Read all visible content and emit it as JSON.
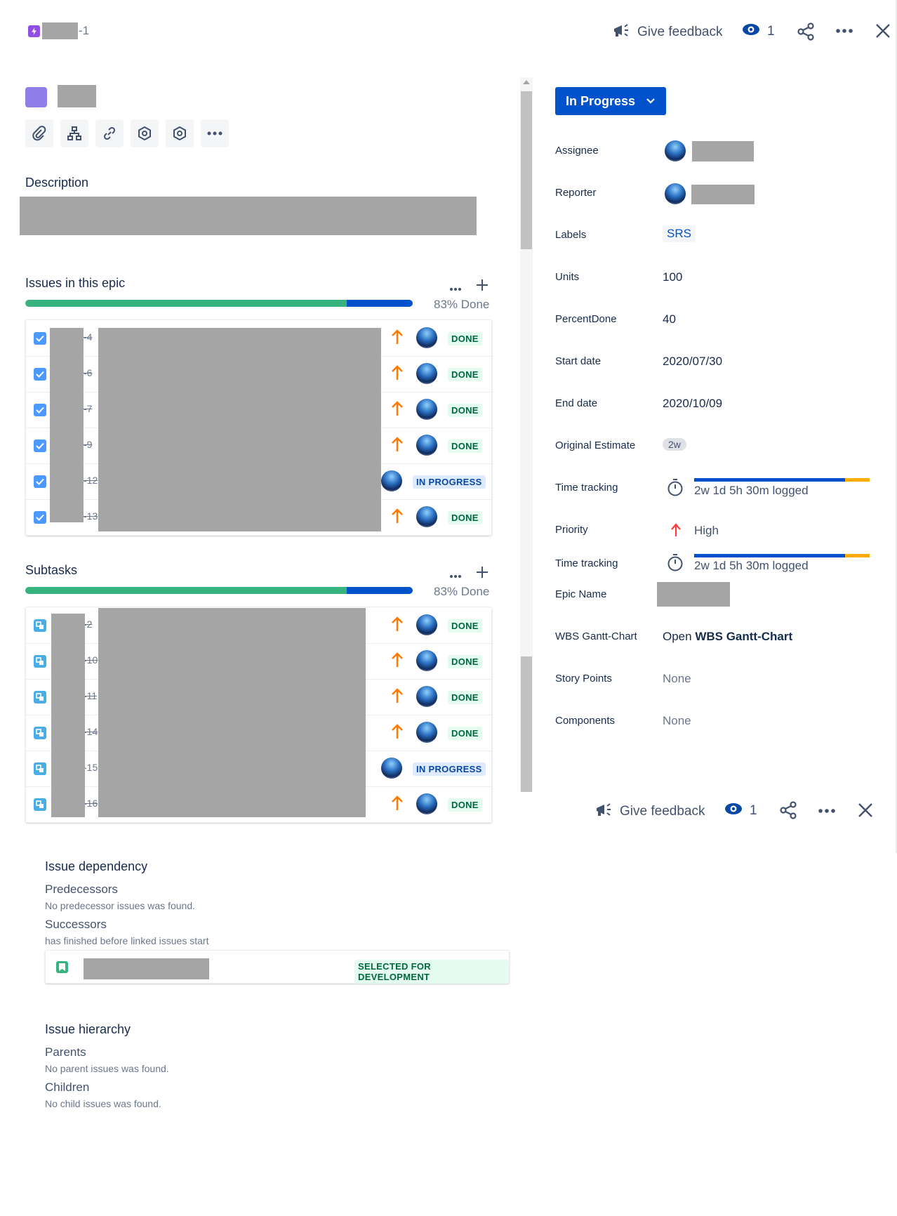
{
  "header": {
    "issue_key_suffix": "-1",
    "give_feedback": "Give feedback",
    "watchers_count": "1"
  },
  "description": {
    "heading": "Description"
  },
  "epic_issues": {
    "heading": "Issues in this epic",
    "progress_label": "83% Done",
    "progress_done_fraction": 0.83,
    "rows": [
      {
        "key": "-4",
        "status": "DONE"
      },
      {
        "key": "-6",
        "status": "DONE"
      },
      {
        "key": "-7",
        "status": "DONE"
      },
      {
        "key": "-9",
        "status": "DONE"
      },
      {
        "key": "-12",
        "status": "IN PROGRESS"
      },
      {
        "key": "-13",
        "status": "DONE"
      }
    ]
  },
  "subtasks": {
    "heading": "Subtasks",
    "progress_label": "83% Done",
    "progress_done_fraction": 0.83,
    "rows": [
      {
        "key": "-2",
        "status": "DONE"
      },
      {
        "key": "-10",
        "status": "DONE"
      },
      {
        "key": "-11",
        "status": "DONE"
      },
      {
        "key": "-14",
        "status": "DONE"
      },
      {
        "key": "-15",
        "status": "IN PROGRESS"
      },
      {
        "key": "-16",
        "status": "DONE"
      }
    ]
  },
  "dependency": {
    "heading": "Issue dependency",
    "predecessors_label": "Predecessors",
    "predecessors_note": "No predecessor issues was found.",
    "successors_label": "Successors",
    "successors_note": "has finished before linked issues start",
    "linked_status": "SELECTED FOR DEVELOPMENT"
  },
  "hierarchy": {
    "heading": "Issue hierarchy",
    "parents_label": "Parents",
    "parents_note": "No parent issues was found.",
    "children_label": "Children",
    "children_note": "No child issues was found."
  },
  "sidebar": {
    "status_button": "In Progress",
    "fields": {
      "assignee": "Assignee",
      "reporter": "Reporter",
      "labels": "Labels",
      "labels_value": "SRS",
      "units": "Units",
      "units_value": "100",
      "percent_done": "PercentDone",
      "percent_done_value": "40",
      "start_date": "Start date",
      "start_date_value": "2020/07/30",
      "end_date": "End date",
      "end_date_value": "2020/10/09",
      "original_estimate": "Original Estimate",
      "original_estimate_value": "2w",
      "time_tracking": "Time tracking",
      "time_tracking_value": "2w 1d 5h 30m logged",
      "time_logged_fraction": 0.86,
      "priority": "Priority",
      "priority_value": "High",
      "epic_name": "Epic Name",
      "wbs": "WBS Gantt-Chart",
      "wbs_open": "Open",
      "wbs_link": "WBS Gantt-Chart",
      "story_points": "Story Points",
      "story_points_value": "None",
      "components": "Components",
      "components_value": "None"
    }
  },
  "colors": {
    "progress_done": "#36b37e",
    "progress_inprogress": "#0052cc",
    "priority_orange": "#ff7a00",
    "priority_red": "#ff3b3b",
    "brand_blue": "#0052cc"
  }
}
